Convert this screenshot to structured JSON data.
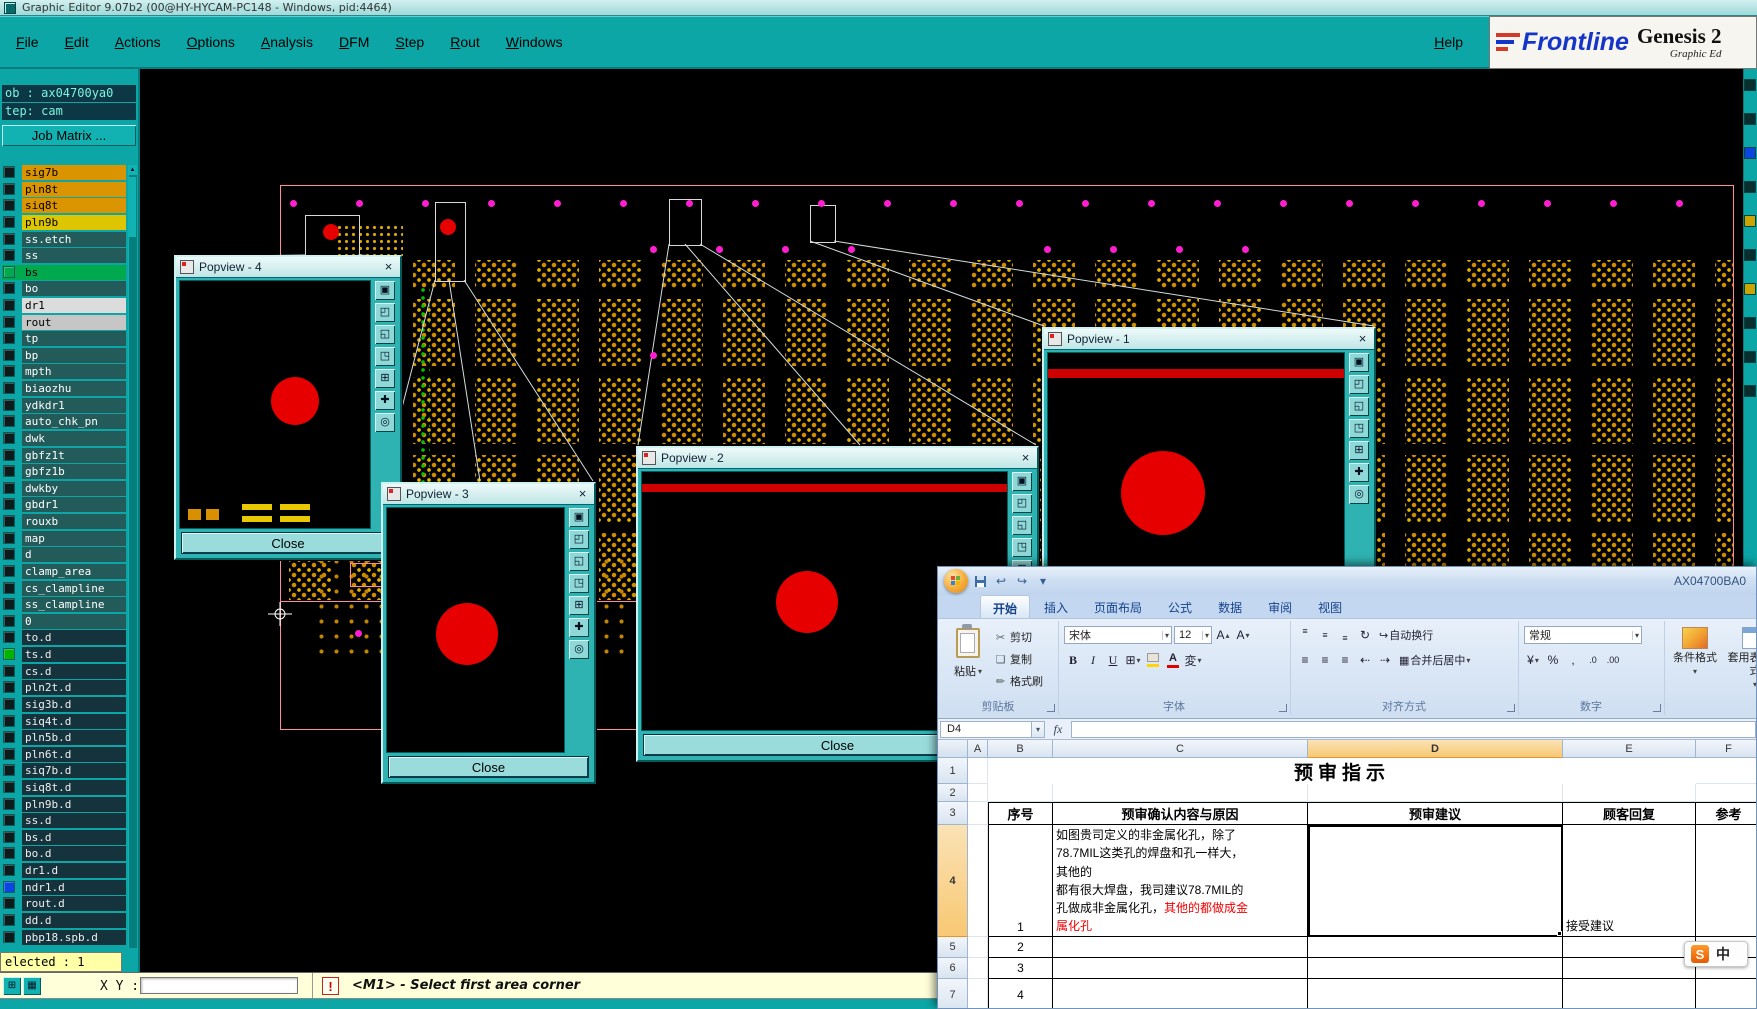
{
  "window": {
    "title": "Graphic Editor 9.07b2 (00@HY-HYCAM-PC148 - Windows, pid:4464)",
    "help": "Help"
  },
  "menubar": {
    "items": [
      "File",
      "Edit",
      "Actions",
      "Options",
      "Analysis",
      "DFM",
      "Step",
      "Rout",
      "Windows"
    ]
  },
  "brand": {
    "name": "Frontline",
    "product": "Genesis 2",
    "tagline": "Graphic Ed"
  },
  "sidebar": {
    "job": "ob : ax04700ya0",
    "step": "tep: cam",
    "job_matrix": "Job Matrix ...",
    "selected": "elected : 1",
    "layers": [
      {
        "name": "sig7b",
        "bg": "#d99400",
        "fg": "#000000",
        "sw": "#0c1c1c"
      },
      {
        "name": "pln8t",
        "bg": "#d99400",
        "fg": "#000000",
        "sw": "#0c1c1c"
      },
      {
        "name": "siq8t",
        "bg": "#d99400",
        "fg": "#000000",
        "sw": "#0c1c1c"
      },
      {
        "name": "pln9b",
        "bg": "#ddc500",
        "fg": "#000000",
        "sw": "#0c1c1c"
      },
      {
        "name": "ss.etch",
        "bg": "#235a5a",
        "fg": "#ffffff",
        "sw": "#0c1c1c"
      },
      {
        "name": "ss",
        "bg": "#235a5a",
        "fg": "#ffffff",
        "sw": "#0c1c1c"
      },
      {
        "name": "bs",
        "bg": "#00a84e",
        "fg": "#000000",
        "sw": "#00a84e",
        "selected": true
      },
      {
        "name": "bo",
        "bg": "#235a5a",
        "fg": "#ffffff",
        "sw": "#0c1c1c"
      },
      {
        "name": "dr1",
        "bg": "#dcdcdc",
        "fg": "#000000",
        "sw": "#0c1c1c"
      },
      {
        "name": "rout",
        "bg": "#c6c6c6",
        "fg": "#000000",
        "sw": "#0c1c1c"
      },
      {
        "name": "tp",
        "bg": "#235a5a",
        "fg": "#ffffff",
        "sw": "#0c1c1c"
      },
      {
        "name": "bp",
        "bg": "#235a5a",
        "fg": "#ffffff",
        "sw": "#0c1c1c"
      },
      {
        "name": "mpth",
        "bg": "#235a5a",
        "fg": "#ffffff",
        "sw": "#0c1c1c"
      },
      {
        "name": "biaozhu",
        "bg": "#235a5a",
        "fg": "#ffffff",
        "sw": "#0c1c1c"
      },
      {
        "name": "ydkdr1",
        "bg": "#235a5a",
        "fg": "#ffffff",
        "sw": "#0c1c1c"
      },
      {
        "name": "auto_chk_pn",
        "bg": "#235a5a",
        "fg": "#ffffff",
        "sw": "#0c1c1c"
      },
      {
        "name": "dwk",
        "bg": "#235a5a",
        "fg": "#ffffff",
        "sw": "#0c1c1c"
      },
      {
        "name": "gbfz1t",
        "bg": "#235a5a",
        "fg": "#ffffff",
        "sw": "#0c1c1c"
      },
      {
        "name": "gbfz1b",
        "bg": "#235a5a",
        "fg": "#ffffff",
        "sw": "#0c1c1c"
      },
      {
        "name": "dwkby",
        "bg": "#235a5a",
        "fg": "#ffffff",
        "sw": "#0c1c1c"
      },
      {
        "name": "gbdr1",
        "bg": "#235a5a",
        "fg": "#ffffff",
        "sw": "#0c1c1c"
      },
      {
        "name": "rouxb",
        "bg": "#235a5a",
        "fg": "#ffffff",
        "sw": "#0c1c1c"
      },
      {
        "name": "map",
        "bg": "#235a5a",
        "fg": "#ffffff",
        "sw": "#0c1c1c"
      },
      {
        "name": "d",
        "bg": "#235a5a",
        "fg": "#ffffff",
        "sw": "#0c1c1c"
      },
      {
        "name": "clamp_area",
        "bg": "#235a5a",
        "fg": "#ffffff",
        "sw": "#0c1c1c"
      },
      {
        "name": "cs_clampline",
        "bg": "#235a5a",
        "fg": "#ffffff",
        "sw": "#0c1c1c"
      },
      {
        "name": "ss_clampline",
        "bg": "#235a5a",
        "fg": "#ffffff",
        "sw": "#0c1c1c"
      },
      {
        "name": "0",
        "bg": "#235a5a",
        "fg": "#ffffff",
        "sw": "#0c1c1c"
      },
      {
        "name": "to.d",
        "bg": "#15333d",
        "fg": "#efefef",
        "sw": "#0c1c1c"
      },
      {
        "name": "ts.d",
        "bg": "#15333d",
        "fg": "#efefef",
        "sw": "#00b400"
      },
      {
        "name": "cs.d",
        "bg": "#15333d",
        "fg": "#efefef",
        "sw": "#0c1c1c"
      },
      {
        "name": "pln2t.d",
        "bg": "#15333d",
        "fg": "#efefef",
        "sw": "#0c1c1c"
      },
      {
        "name": "sig3b.d",
        "bg": "#15333d",
        "fg": "#efefef",
        "sw": "#0c1c1c"
      },
      {
        "name": "siq4t.d",
        "bg": "#15333d",
        "fg": "#efefef",
        "sw": "#0c1c1c"
      },
      {
        "name": "pln5b.d",
        "bg": "#15333d",
        "fg": "#efefef",
        "sw": "#0c1c1c"
      },
      {
        "name": "pln6t.d",
        "bg": "#15333d",
        "fg": "#efefef",
        "sw": "#0c1c1c"
      },
      {
        "name": "siq7b.d",
        "bg": "#15333d",
        "fg": "#efefef",
        "sw": "#0c1c1c"
      },
      {
        "name": "siq8t.d",
        "bg": "#15333d",
        "fg": "#efefef",
        "sw": "#0c1c1c"
      },
      {
        "name": "pln9b.d",
        "bg": "#15333d",
        "fg": "#efefef",
        "sw": "#0c1c1c"
      },
      {
        "name": "ss.d",
        "bg": "#15333d",
        "fg": "#efefef",
        "sw": "#0c1c1c"
      },
      {
        "name": "bs.d",
        "bg": "#15333d",
        "fg": "#efefef",
        "sw": "#0c1c1c"
      },
      {
        "name": "bo.d",
        "bg": "#15333d",
        "fg": "#efefef",
        "sw": "#0c1c1c"
      },
      {
        "name": "dr1.d",
        "bg": "#15333d",
        "fg": "#efefef",
        "sw": "#0c1c1c"
      },
      {
        "name": "ndr1.d",
        "bg": "#15333d",
        "fg": "#efefef",
        "sw": "#0b46e0"
      },
      {
        "name": "rout.d",
        "bg": "#15333d",
        "fg": "#efefef",
        "sw": "#0c1c1c"
      },
      {
        "name": "dd.d",
        "bg": "#15333d",
        "fg": "#efefef",
        "sw": "#0c1c1c"
      },
      {
        "name": "pbp18.spb.d",
        "bg": "#15333d",
        "fg": "#efefef",
        "sw": "#0c1c1c"
      }
    ]
  },
  "popviews": {
    "close_label": "Close",
    "windows": [
      {
        "title": "Popview - 1"
      },
      {
        "title": "Popview - 2"
      },
      {
        "title": "Popview - 3"
      },
      {
        "title": "Popview - 4"
      }
    ]
  },
  "statusbar": {
    "xy_label": "X Y :",
    "input_value": "",
    "alert": "!",
    "message": "<M1> - Select first area corner"
  },
  "excel": {
    "title": "AX04700BA0",
    "tabs": [
      "开始",
      "插入",
      "页面布局",
      "公式",
      "数据",
      "审阅",
      "视图"
    ],
    "active_tab": "开始",
    "name_box": "D4",
    "fx": "fx",
    "ribbon": {
      "clipboard": {
        "label": "剪贴板",
        "paste": "粘贴",
        "cut": "剪切",
        "copy": "复制",
        "painter": "格式刷"
      },
      "font": {
        "label": "字体",
        "family": "宋体",
        "size": "12",
        "bold": "B",
        "italic": "I",
        "underline": "U"
      },
      "align": {
        "label": "对齐方式",
        "wrap": "自动换行",
        "merge": "合并后居中"
      },
      "number": {
        "label": "数字",
        "format": "常规"
      },
      "styles": {
        "conditional": "条件格式",
        "table": "套用表格格式"
      }
    },
    "grid": {
      "columns": [
        "A",
        "B",
        "C",
        "D",
        "E",
        "F"
      ],
      "rows": [
        "1",
        "2",
        "3",
        "4",
        "5",
        "6",
        "7"
      ],
      "title": "预审指示",
      "headers": {
        "no": "序号",
        "content": "预审确认内容与原因",
        "suggestion": "预审建议",
        "reply": "顾客回复",
        "ref": "参考"
      },
      "row4": {
        "no": "1",
        "reply": "接受建议",
        "content_lines": [
          {
            "black": "如图贵司定义的非金属化孔，除了",
            "red": ""
          },
          {
            "black": "78.7MIL这类孔的焊盘和孔一样大，",
            "red": ""
          },
          {
            "black": "其他的",
            "red": ""
          },
          {
            "black": "都有很大焊盘，我司建议78.7MIL的",
            "red": ""
          },
          {
            "black": "孔做成非金属化孔，",
            "red": "其他的都做成金"
          },
          {
            "black": "",
            "red": "属化孔"
          }
        ]
      },
      "row5_no": "2",
      "row6_no": "3",
      "row7_no": "4"
    },
    "ime": {
      "s": "S",
      "zh": "中"
    }
  }
}
